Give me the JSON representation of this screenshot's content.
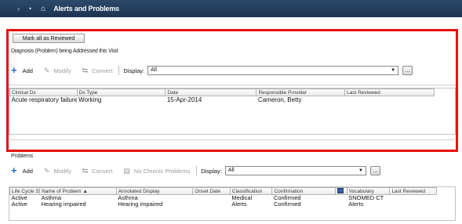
{
  "titlebar": {
    "nav_glyphs": "›  •",
    "home_icon": "home-icon",
    "title": "Alerts and Problems"
  },
  "mark_all_label": "Mark all as Reviewed",
  "diagnosis": {
    "section_label": "Diagnosis (Problem) being Addressed this Visit",
    "toolbar": {
      "add": "Add",
      "modify": "Modify",
      "convert": "Convert",
      "display_label": "Display:",
      "display_value": "All",
      "ellipsis": "..."
    },
    "columns": [
      "Clinical Dx",
      "Dx Type",
      "Date",
      "Responsible Provider",
      "Last Reviewed"
    ],
    "rows": [
      [
        "Acute respiratory failure",
        "Working",
        "15-Apr-2014",
        "Cameron, Betty",
        ""
      ]
    ]
  },
  "problems": {
    "section_label": "Problems",
    "toolbar": {
      "add": "Add",
      "modify": "Modify",
      "convert": "Convert",
      "no_chronic": "No Chronic Problems",
      "display_label": "Display:",
      "display_value": "All",
      "ellipsis": "..."
    },
    "columns": [
      "Life Cycle St.",
      "Name of Problem ▲",
      "Annotated Display",
      "Onset Date",
      "Classification",
      "Confirmation",
      "",
      "Vocabulary",
      "Last Reviewed"
    ],
    "rows": [
      [
        "Active",
        "Asthma",
        "Asthma",
        "",
        "Medical",
        "Confirmed",
        "",
        "SNOMED CT",
        ""
      ],
      [
        "Active",
        "Hearing impaired",
        "Hearing impaired",
        "",
        "Alerts",
        "Confirmed",
        "",
        "Alerts",
        ""
      ]
    ]
  },
  "colors": {
    "titlebar": "#1c3350",
    "highlight": "#e81010",
    "add_accent": "#1e6fd0"
  }
}
